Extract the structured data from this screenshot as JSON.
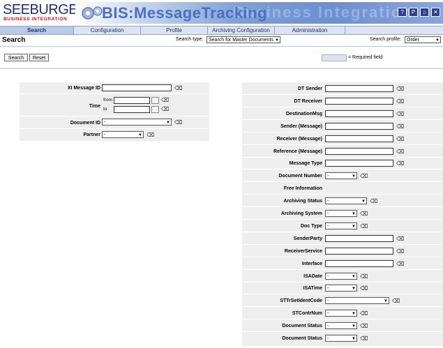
{
  "header": {
    "logo_main": "SEEBURGER",
    "logo_sub": "BUSINESS INTEGRATION",
    "banner_title": "BIS:MessageTracking",
    "banner_bg_text": "Business Integration",
    "window_buttons": [
      "?",
      "P",
      "⌂",
      "✕"
    ]
  },
  "nav": {
    "tabs": [
      {
        "label": "Search",
        "active": true
      },
      {
        "label": "Configuration",
        "active": false
      },
      {
        "label": "Profile",
        "active": false
      },
      {
        "label": "Archiving Configuration",
        "active": false
      },
      {
        "label": "Administration",
        "active": false
      }
    ]
  },
  "search_bar": {
    "title": "Search",
    "search_type_label": "Search type:",
    "search_type_value": "Search for Master Documents",
    "search_profile_label": "Search profile:",
    "search_profile_value": "Order"
  },
  "actions": {
    "search_label": "Search",
    "reset_label": "Reset",
    "required_label": "= Required field"
  },
  "left_form": {
    "xi_message_id": "XI Message ID",
    "time": "Time",
    "from": "from",
    "to": "to",
    "document_id": "Document ID",
    "document_id_value": "-",
    "partner": "Partner",
    "partner_value": "-"
  },
  "right_form": {
    "fields": [
      {
        "label": "DT Sender",
        "kind": "text"
      },
      {
        "label": "DT Receiver",
        "kind": "text"
      },
      {
        "label": "DestinationMsg",
        "kind": "text"
      },
      {
        "label": "Sender (Message)",
        "kind": "text"
      },
      {
        "label": "Receiver (Message)",
        "kind": "text"
      },
      {
        "label": "Reference (Message)",
        "kind": "text"
      },
      {
        "label": "Message Type",
        "kind": "text"
      },
      {
        "label": "Document Number",
        "kind": "select",
        "value": "-"
      },
      {
        "label": "Free Information",
        "kind": "none"
      },
      {
        "label": "Archiving Status",
        "kind": "select-wide",
        "value": "-"
      },
      {
        "label": "Archiving System",
        "kind": "select",
        "value": "-"
      },
      {
        "label": "Doc Type",
        "kind": "select",
        "value": "-"
      },
      {
        "label": "SenderParty",
        "kind": "text"
      },
      {
        "label": "ReceiverService",
        "kind": "text"
      },
      {
        "label": "Interface",
        "kind": "text"
      },
      {
        "label": "ISADate",
        "kind": "select",
        "value": "-"
      },
      {
        "label": "ISATime",
        "kind": "select",
        "value": "-"
      },
      {
        "label": "STTrSetIdentCode",
        "kind": "select-xwide",
        "value": "-"
      },
      {
        "label": "STContrNum",
        "kind": "select",
        "value": "-"
      },
      {
        "label": "Document Status",
        "kind": "select",
        "value": "-"
      },
      {
        "label": "Document Status",
        "kind": "select",
        "value": "-"
      }
    ]
  },
  "icons": {
    "eraser": "eraser-icon",
    "calendar": "calendar-icon",
    "dropdown": "chevron-down-icon"
  },
  "colors": {
    "brand_navy": "#1f2f6e",
    "brand_red": "#c8101f",
    "nav_bg": "#dbe4f4",
    "panel_bg": "#eeeeee"
  }
}
